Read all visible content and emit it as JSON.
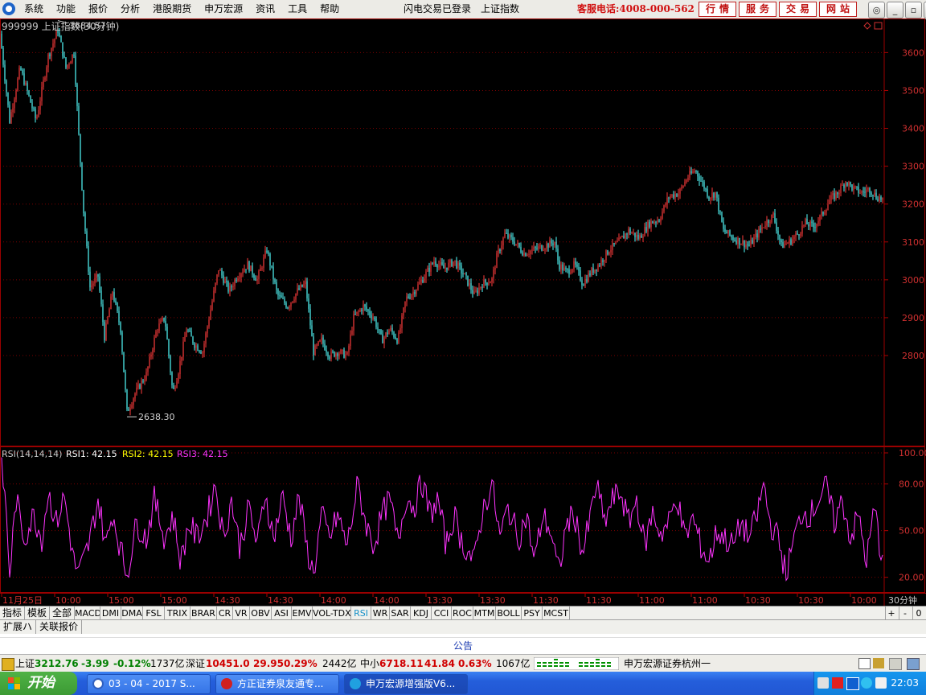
{
  "app": {
    "menu": [
      "系统",
      "功能",
      "报价",
      "分析",
      "港股期货",
      "申万宏源",
      "资讯",
      "工具",
      "帮助"
    ],
    "status_login": "闪电交易已登录",
    "status_index": "上证指数",
    "hotline": "客服电话:4008-000-562",
    "quick_buttons": [
      "行情",
      "服务",
      "交易",
      "网站"
    ],
    "window_buttons": [
      "◎",
      "_",
      "▫",
      "✕"
    ]
  },
  "chart_data": [
    {
      "type": "candlestick",
      "title": "999999 上证指数(30分钟)",
      "ylim": [
        2560,
        3690
      ],
      "y_ticks": [
        2800,
        2900,
        3000,
        3100,
        3200,
        3300,
        3400,
        3500,
        3600
      ],
      "grid": true,
      "annotations": [
        {
          "label": "3684.57",
          "value": 3684.57,
          "at_bar": 72
        },
        {
          "label": "2638.30",
          "value": 2638.3,
          "at_bar": 158
        }
      ],
      "up_color": "#ff3c3c",
      "down_color": "#54ffff",
      "close_anchors": [
        [
          0,
          3650
        ],
        [
          12,
          3420
        ],
        [
          25,
          3560
        ],
        [
          45,
          3420
        ],
        [
          60,
          3590
        ],
        [
          72,
          3660
        ],
        [
          82,
          3560
        ],
        [
          92,
          3600
        ],
        [
          98,
          3380
        ],
        [
          104,
          3180
        ],
        [
          112,
          2980
        ],
        [
          122,
          3010
        ],
        [
          130,
          2850
        ],
        [
          140,
          2970
        ],
        [
          150,
          2870
        ],
        [
          158,
          2650
        ],
        [
          168,
          2700
        ],
        [
          182,
          2750
        ],
        [
          195,
          2870
        ],
        [
          205,
          2900
        ],
        [
          215,
          2700
        ],
        [
          222,
          2760
        ],
        [
          232,
          2870
        ],
        [
          242,
          2830
        ],
        [
          252,
          2810
        ],
        [
          260,
          2900
        ],
        [
          272,
          3030
        ],
        [
          285,
          2970
        ],
        [
          295,
          3010
        ],
        [
          308,
          3040
        ],
        [
          320,
          3000
        ],
        [
          332,
          3080
        ],
        [
          345,
          2960
        ],
        [
          358,
          2930
        ],
        [
          370,
          2970
        ],
        [
          380,
          2990
        ],
        [
          390,
          2810
        ],
        [
          400,
          2840
        ],
        [
          410,
          2800
        ],
        [
          420,
          2810
        ],
        [
          432,
          2800
        ],
        [
          440,
          2900
        ],
        [
          452,
          2930
        ],
        [
          465,
          2900
        ],
        [
          475,
          2840
        ],
        [
          485,
          2870
        ],
        [
          495,
          2840
        ],
        [
          505,
          2950
        ],
        [
          515,
          2970
        ],
        [
          525,
          3000
        ],
        [
          540,
          3050
        ],
        [
          552,
          3030
        ],
        [
          565,
          3050
        ],
        [
          578,
          3010
        ],
        [
          590,
          2960
        ],
        [
          600,
          2990
        ],
        [
          612,
          3000
        ],
        [
          618,
          3060
        ],
        [
          628,
          3120
        ],
        [
          640,
          3100
        ],
        [
          652,
          3070
        ],
        [
          665,
          3080
        ],
        [
          678,
          3090
        ],
        [
          690,
          3100
        ],
        [
          695,
          3040
        ],
        [
          705,
          3020
        ],
        [
          715,
          3040
        ],
        [
          725,
          2990
        ],
        [
          735,
          3020
        ],
        [
          745,
          3040
        ],
        [
          758,
          3080
        ],
        [
          770,
          3100
        ],
        [
          782,
          3130
        ],
        [
          795,
          3110
        ],
        [
          808,
          3150
        ],
        [
          820,
          3160
        ],
        [
          832,
          3220
        ],
        [
          845,
          3230
        ],
        [
          855,
          3270
        ],
        [
          865,
          3290
        ],
        [
          875,
          3250
        ],
        [
          882,
          3220
        ],
        [
          890,
          3230
        ],
        [
          900,
          3130
        ],
        [
          912,
          3110
        ],
        [
          922,
          3100
        ],
        [
          932,
          3090
        ],
        [
          942,
          3120
        ],
        [
          952,
          3150
        ],
        [
          962,
          3170
        ],
        [
          972,
          3090
        ],
        [
          982,
          3100
        ],
        [
          992,
          3120
        ],
        [
          1002,
          3150
        ],
        [
          1012,
          3140
        ],
        [
          1022,
          3170
        ],
        [
          1032,
          3210
        ],
        [
          1042,
          3230
        ],
        [
          1052,
          3260
        ],
        [
          1062,
          3240
        ],
        [
          1072,
          3230
        ],
        [
          1082,
          3240
        ],
        [
          1090,
          3220
        ],
        [
          1098,
          3213
        ]
      ]
    },
    {
      "type": "line",
      "title": "RSI(14,14,14)",
      "ylim": [
        10,
        100
      ],
      "y_ticks": [
        20,
        50,
        80,
        100
      ],
      "series": [
        {
          "label": "RSI1:",
          "value": "42.15",
          "color": "#ffffff"
        },
        {
          "label": "RSI2:",
          "value": "42.15",
          "color": "#ffff00"
        },
        {
          "label": "RSI3:",
          "value": "42.15",
          "color": "#ff33ff"
        }
      ],
      "envelope_anchors": [
        [
          0,
          95
        ],
        [
          6,
          75
        ],
        [
          12,
          22
        ],
        [
          20,
          70
        ],
        [
          30,
          45
        ],
        [
          42,
          60
        ],
        [
          52,
          45
        ],
        [
          60,
          75
        ],
        [
          70,
          55
        ],
        [
          80,
          72
        ],
        [
          92,
          30
        ],
        [
          98,
          22
        ],
        [
          110,
          40
        ],
        [
          122,
          70
        ],
        [
          132,
          40
        ],
        [
          140,
          62
        ],
        [
          150,
          38
        ],
        [
          158,
          22
        ],
        [
          170,
          55
        ],
        [
          182,
          45
        ],
        [
          192,
          70
        ],
        [
          205,
          45
        ],
        [
          215,
          60
        ],
        [
          225,
          30
        ],
        [
          235,
          55
        ],
        [
          245,
          45
        ],
        [
          258,
          60
        ],
        [
          268,
          80
        ],
        [
          278,
          45
        ],
        [
          288,
          70
        ],
        [
          298,
          40
        ],
        [
          310,
          65
        ],
        [
          320,
          40
        ],
        [
          330,
          75
        ],
        [
          340,
          45
        ],
        [
          352,
          72
        ],
        [
          362,
          45
        ],
        [
          372,
          72
        ],
        [
          382,
          38
        ],
        [
          390,
          22
        ],
        [
          400,
          60
        ],
        [
          410,
          45
        ],
        [
          420,
          60
        ],
        [
          432,
          40
        ],
        [
          445,
          80
        ],
        [
          455,
          55
        ],
        [
          465,
          40
        ],
        [
          475,
          60
        ],
        [
          485,
          70
        ],
        [
          495,
          42
        ],
        [
          505,
          72
        ],
        [
          515,
          65
        ],
        [
          525,
          82
        ],
        [
          535,
          60
        ],
        [
          545,
          70
        ],
        [
          555,
          40
        ],
        [
          565,
          60
        ],
        [
          575,
          42
        ],
        [
          590,
          30
        ],
        [
          600,
          62
        ],
        [
          612,
          80
        ],
        [
          622,
          45
        ],
        [
          632,
          65
        ],
        [
          645,
          45
        ],
        [
          655,
          60
        ],
        [
          665,
          30
        ],
        [
          675,
          60
        ],
        [
          685,
          50
        ],
        [
          695,
          22
        ],
        [
          705,
          55
        ],
        [
          715,
          60
        ],
        [
          725,
          35
        ],
        [
          735,
          60
        ],
        [
          742,
          80
        ],
        [
          752,
          55
        ],
        [
          762,
          70
        ],
        [
          772,
          75
        ],
        [
          782,
          55
        ],
        [
          792,
          70
        ],
        [
          802,
          40
        ],
        [
          812,
          62
        ],
        [
          822,
          48
        ],
        [
          832,
          55
        ],
        [
          842,
          72
        ],
        [
          852,
          45
        ],
        [
          862,
          58
        ],
        [
          872,
          40
        ],
        [
          882,
          30
        ],
        [
          892,
          50
        ],
        [
          902,
          45
        ],
        [
          912,
          40
        ],
        [
          922,
          55
        ],
        [
          932,
          45
        ],
        [
          942,
          60
        ],
        [
          950,
          80
        ],
        [
          958,
          55
        ],
        [
          968,
          45
        ],
        [
          978,
          22
        ],
        [
          988,
          45
        ],
        [
          998,
          62
        ],
        [
          1008,
          60
        ],
        [
          1018,
          70
        ],
        [
          1028,
          78
        ],
        [
          1038,
          55
        ],
        [
          1048,
          70
        ],
        [
          1058,
          45
        ],
        [
          1068,
          60
        ],
        [
          1078,
          30
        ],
        [
          1088,
          65
        ],
        [
          1096,
          35
        ],
        [
          1100,
          45
        ]
      ]
    }
  ],
  "time_axis": {
    "labels": [
      "11月25日",
      "10:00",
      "15:00",
      "15:00",
      "14:30",
      "14:30",
      "14:00",
      "14:00",
      "13:30",
      "13:30",
      "11:30",
      "11:30",
      "11:00",
      "11:00",
      "10:30",
      "10:30",
      "10:00"
    ],
    "right_label": "30分钟"
  },
  "tabs": {
    "cn": [
      "指标",
      "模板",
      "全部"
    ],
    "indicators": [
      "MACD",
      "DMI",
      "DMA",
      "FSL",
      "TRIX",
      "BRAR",
      "CR",
      "VR",
      "OBV",
      "ASI",
      "EMV",
      "VOL-TDX",
      "RSI",
      "WR",
      "SAR",
      "KDJ",
      "CCI",
      "ROC",
      "MTM",
      "BOLL",
      "PSY",
      "MCST"
    ],
    "active": "RSI",
    "controls": [
      "+",
      "-",
      "0"
    ],
    "row2": [
      "扩展ハ",
      "关联报价"
    ]
  },
  "notice": "公告",
  "ticker": {
    "sh_name": "上证",
    "sh_price": "3212.76",
    "sh_change": "-3.99",
    "sh_pct": "-0.12%",
    "sh_amount": "1737亿",
    "sz_name": "深证",
    "sz_price": "10451.0",
    "sz_change": "29.95",
    "sz_pct": "0.29%",
    "sz_amount": "2442亿",
    "zx_name": "中小",
    "zx_price": "6718.11",
    "zx_change": "41.84",
    "zx_pct": "0.63%",
    "zx_amount": "1067亿",
    "broker": "申万宏源证券杭州一"
  },
  "taskbar": {
    "start": "开始",
    "tasks": [
      "03 - 04 - 2017 S...",
      "方正证券泉友通专...",
      "申万宏源增强版V6..."
    ],
    "clock": "22:03"
  }
}
